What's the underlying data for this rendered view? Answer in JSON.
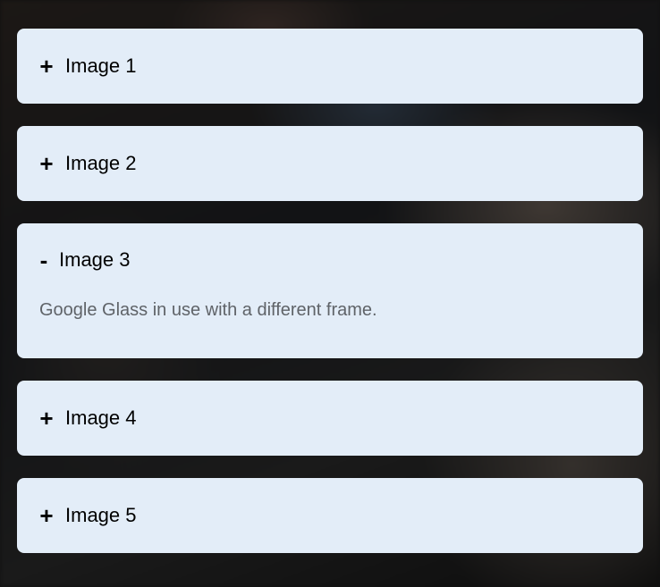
{
  "accordion": {
    "items": [
      {
        "label": "Image 1",
        "toggle": "+",
        "expanded": false
      },
      {
        "label": "Image 2",
        "toggle": "+",
        "expanded": false
      },
      {
        "label": "Image 3",
        "toggle": "-",
        "expanded": true,
        "caption": "Google Glass in use with a different frame."
      },
      {
        "label": "Image 4",
        "toggle": "+",
        "expanded": false
      },
      {
        "label": "Image 5",
        "toggle": "+",
        "expanded": false
      }
    ]
  },
  "colors": {
    "panel_background": "#e3edf8",
    "caption_text": "#5f6368",
    "page_background": "#111111"
  }
}
